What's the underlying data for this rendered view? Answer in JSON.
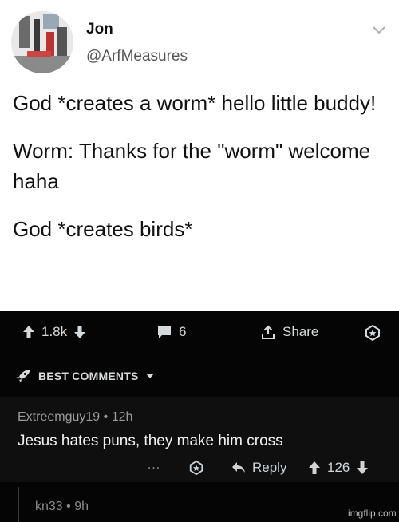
{
  "tweet": {
    "author_name": "Jon",
    "author_handle": "@ArfMeasures",
    "paragraphs": [
      "God *creates a worm* hello little buddy!",
      "Worm: Thanks for the \"worm\" welcome haha",
      "God *creates birds*"
    ]
  },
  "action_bar": {
    "upvote_count": "1.8k",
    "comment_count": "6",
    "share_label": "Share"
  },
  "best_comments_label": "BEST COMMENTS",
  "comment": {
    "author": "Extreemguy19",
    "separator": "•",
    "age": "12h",
    "body": "Jesus hates puns, they make him cross",
    "more_label": "…",
    "reply_label": "Reply",
    "score": "126"
  },
  "reply": {
    "author": "kn33",
    "separator": "•",
    "age": "9h"
  },
  "watermark": "imgflip.com",
  "colors": {
    "tweet_bg": "#ffffff",
    "dark_bg": "#050505",
    "comment_bg": "#0f0f10",
    "text_light": "#d7dadc"
  }
}
